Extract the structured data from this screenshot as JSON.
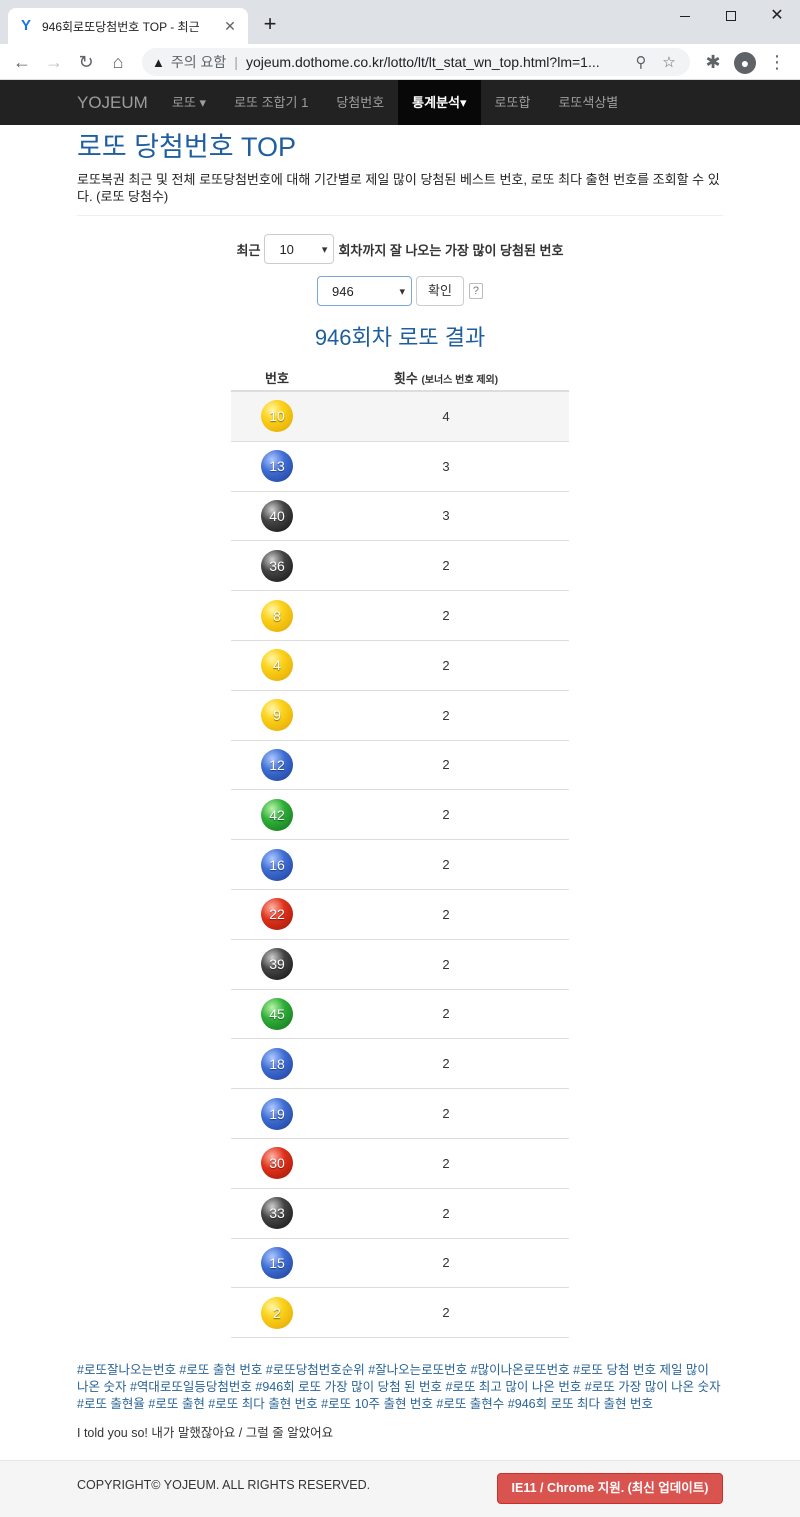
{
  "browser": {
    "tab_title": "946회로또당첨번호 TOP - 최근",
    "favicon": "Y",
    "new_tab": "+",
    "security_warning": "주의 요함",
    "url": "yojeum.dothome.co.kr/lotto/lt/lt_stat_wn_top.html?lm=1..."
  },
  "nav": {
    "brand": "YOJEUM",
    "items": [
      {
        "label": "로또 ▾"
      },
      {
        "label": "로또 조합기 1"
      },
      {
        "label": "당첨번호"
      },
      {
        "label": "통계분석▾"
      },
      {
        "label": "로또합"
      },
      {
        "label": "로또색상별"
      }
    ],
    "active_index": 3
  },
  "page": {
    "title": "로또 당첨번호 TOP",
    "lead": "로또복권 최근 및 전체 로또당첨번호에 대해 기간별로 제일 많이 당첨된 베스트 번호, 로또 최다 출현 번호를 조회할 수 있다. (로또 당첨수)"
  },
  "form": {
    "prefix": "최근",
    "recent_value": "10",
    "suffix": "회차까지 잘 나오는 가장 많이 당첨된 번호",
    "round_value": "946",
    "confirm_label": "확인",
    "help_label": "?"
  },
  "result": {
    "title": "946회차 로또 결과",
    "col_number": "번호",
    "col_count": "횟수",
    "col_count_note": "(보너스 번호 제외)",
    "rows": [
      {
        "num": "10",
        "count": "4",
        "color": "yellow"
      },
      {
        "num": "13",
        "count": "3",
        "color": "blue"
      },
      {
        "num": "40",
        "count": "3",
        "color": "black"
      },
      {
        "num": "36",
        "count": "2",
        "color": "black"
      },
      {
        "num": "8",
        "count": "2",
        "color": "yellow"
      },
      {
        "num": "4",
        "count": "2",
        "color": "yellow"
      },
      {
        "num": "9",
        "count": "2",
        "color": "yellow"
      },
      {
        "num": "12",
        "count": "2",
        "color": "blue"
      },
      {
        "num": "42",
        "count": "2",
        "color": "green"
      },
      {
        "num": "16",
        "count": "2",
        "color": "blue"
      },
      {
        "num": "22",
        "count": "2",
        "color": "red"
      },
      {
        "num": "39",
        "count": "2",
        "color": "black"
      },
      {
        "num": "45",
        "count": "2",
        "color": "green"
      },
      {
        "num": "18",
        "count": "2",
        "color": "blue"
      },
      {
        "num": "19",
        "count": "2",
        "color": "blue"
      },
      {
        "num": "30",
        "count": "2",
        "color": "red"
      },
      {
        "num": "33",
        "count": "2",
        "color": "black"
      },
      {
        "num": "15",
        "count": "2",
        "color": "blue"
      },
      {
        "num": "2",
        "count": "2",
        "color": "yellow"
      }
    ]
  },
  "tags": "#로또잘나오는번호 #로또 출현 번호 #로또당첨번호순위 #잘나오는로또번호 #많이나온로또번호 #로또 당첨 번호 제일 많이 나온 숫자 #역대로또일등당첨번호 #946회 로또 가장 많이 당첨 된 번호 #로또 최고 많이 나온 번호 #로또 가장 많이 나온 숫자 #로또 출현율 #로또 출현 #로또 최다 출현 번호 #로또 10주 출현 번호 #로또 출현수 #946회 로또 최다 출현 번호",
  "note": "I told you so! 내가 말했잖아요 / 그럴 줄 알았어요",
  "footer": {
    "copyright": "COPYRIGHT© YOJEUM. ALL RIGHTS RESERVED.",
    "support_button": "IE11 / Chrome 지원. (최신 업데이트)"
  },
  "colors": {
    "title_blue": "#1f5fa0",
    "navbar_bg": "#222222",
    "danger_red": "#d9534f"
  }
}
